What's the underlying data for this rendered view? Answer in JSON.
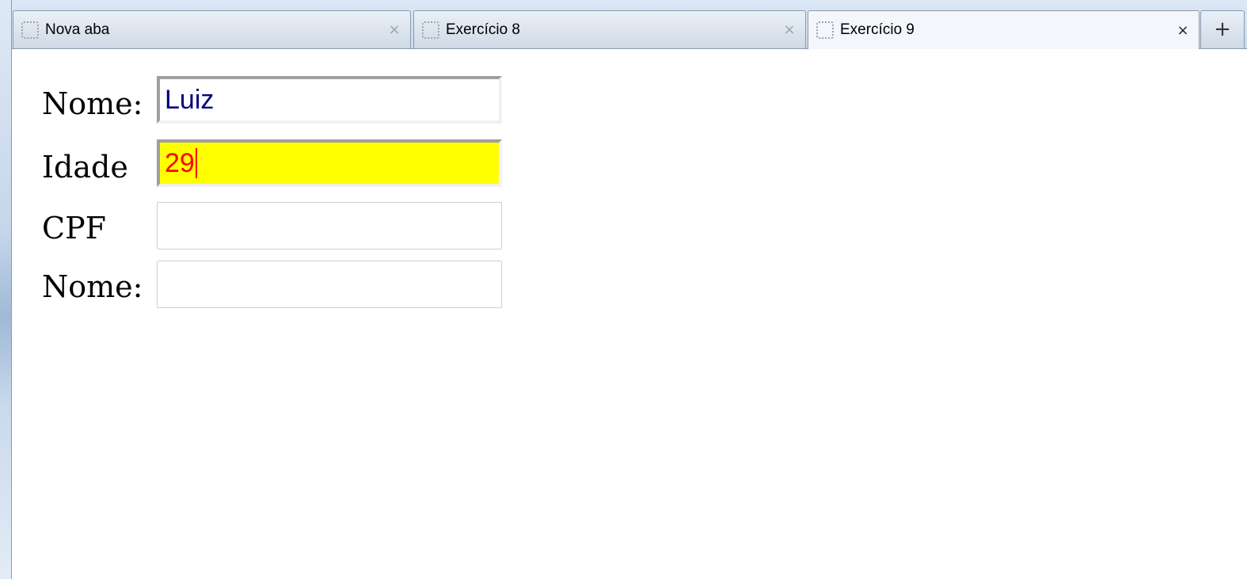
{
  "tabs": [
    {
      "title": "Nova aba",
      "close": "×",
      "active": false
    },
    {
      "title": "Exercício 8",
      "close": "×",
      "active": false
    },
    {
      "title": "Exercício 9",
      "close": "×",
      "active": true
    }
  ],
  "new_tab_label": "+",
  "form": {
    "nome": {
      "label": "Nome:",
      "value": "Luiz",
      "text_color": "#000080",
      "background": "#ffffff"
    },
    "idade": {
      "label": "Idade",
      "value": "29",
      "text_color": "#ff0000",
      "background": "#ffff00"
    },
    "cpf": {
      "label": "CPF",
      "value": ""
    },
    "nome2": {
      "label": "Nome:",
      "value": ""
    }
  }
}
